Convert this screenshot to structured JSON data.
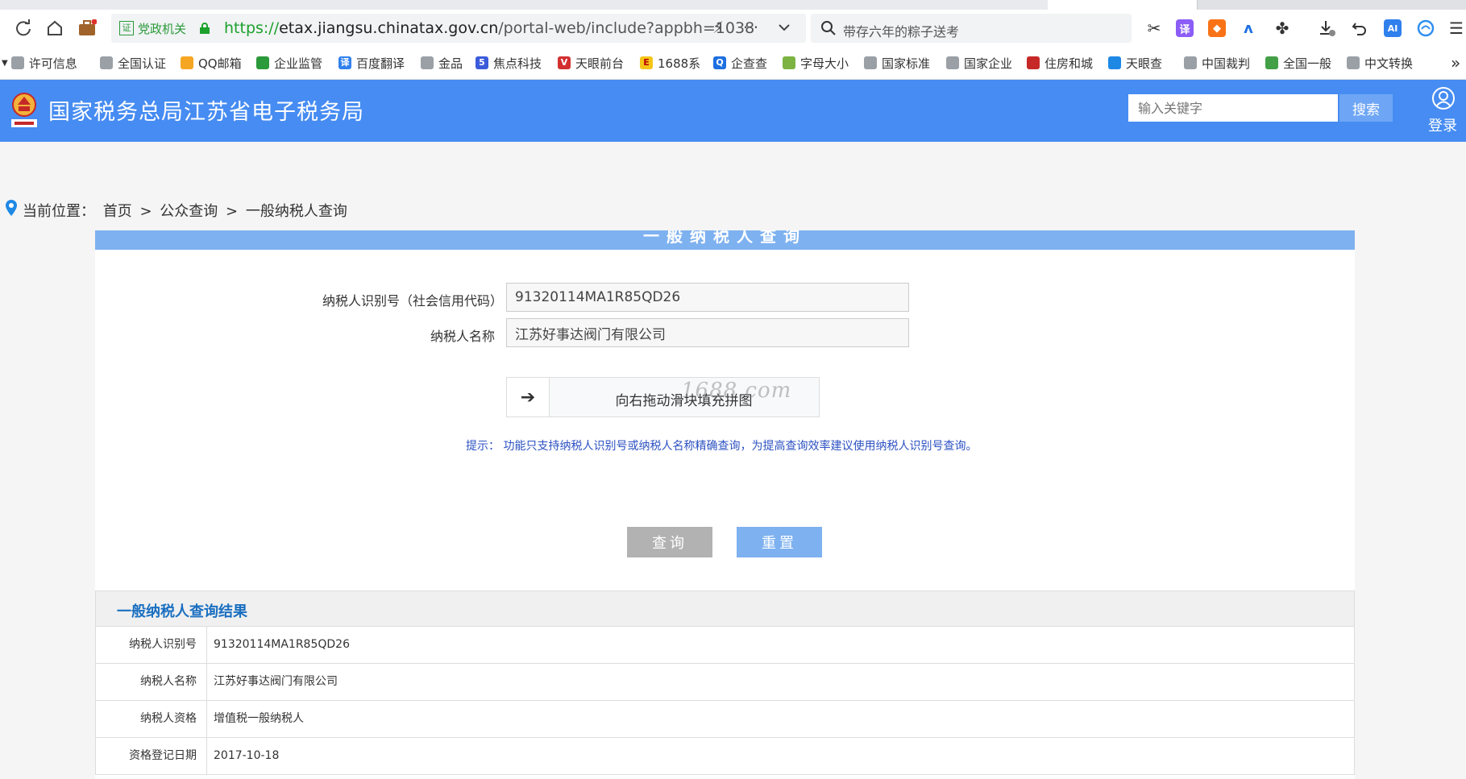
{
  "browser": {
    "url": {
      "protocol": "https://",
      "host": "etax.jiangsu.chinatax.gov.cn",
      "path": "/portal-web/include?appbh=1038"
    },
    "gov_badge": "党政机关",
    "search_placeholder": "带存六年的粽子送考",
    "bookmarks": [
      "许可信息",
      "全国认证",
      "QQ邮箱",
      "企业监管",
      "百度翻译",
      "金品",
      "焦点科技",
      "天眼前台",
      "1688系",
      "企查查",
      "字母大小",
      "国家标准",
      "国家企业",
      "住房和城",
      "天眼查",
      "中国裁判",
      "全国一般",
      "中文转换"
    ],
    "bookmarks_more": "»"
  },
  "site": {
    "title": "国家税务总局江苏省电子税务局",
    "search_placeholder": "输入关键字",
    "search_button": "搜索",
    "login_label": "登录",
    "brand_color": "#468cf2"
  },
  "breadcrumb": {
    "prefix": "当前位置：",
    "items": [
      "首页",
      ">",
      "公众查询",
      ">",
      "一般纳税人查询"
    ]
  },
  "form": {
    "panel_title": "一般纳税人查询",
    "tax_id_label": "纳税人识别号（社会信用代码）",
    "tax_id_value": "91320114MA1R85QD26",
    "name_label": "纳税人名称",
    "name_value": "江苏好事达阀门有限公司",
    "slider_text": "向右拖动滑块填充拼图",
    "watermark": "1688.com",
    "hint": "提示：  功能只支持纳税人识别号或纳税人名称精确查询，为提高查询效率建议使用纳税人识别号查询。",
    "query_button": "查询",
    "reset_button": "重置"
  },
  "result": {
    "title": "一般纳税人查询结果",
    "rows": [
      {
        "key": "纳税人识别号",
        "value": "91320114MA1R85QD26"
      },
      {
        "key": "纳税人名称",
        "value": "江苏好事达阀门有限公司"
      },
      {
        "key": "纳税人资格",
        "value": "增值税一般纳税人"
      },
      {
        "key": "资格登记日期",
        "value": "2017-10-18"
      }
    ]
  }
}
